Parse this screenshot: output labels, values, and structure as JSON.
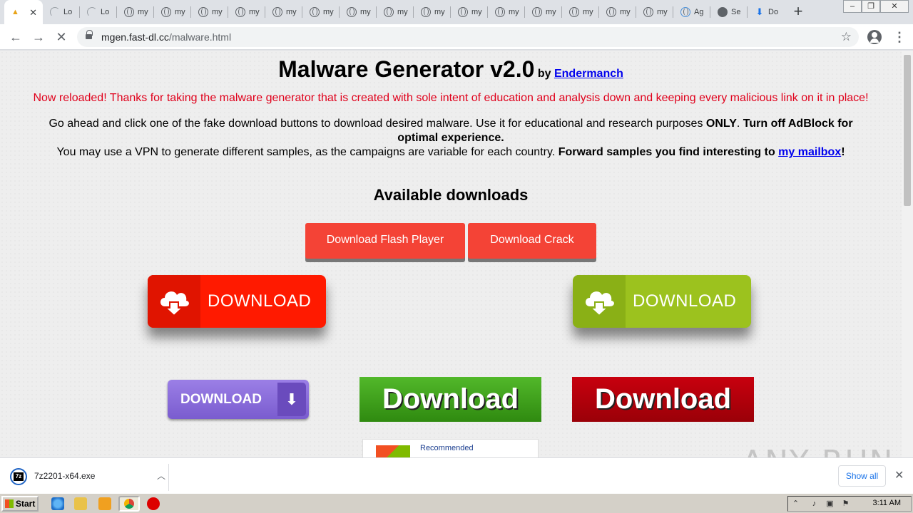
{
  "tabs": [
    {
      "label": "",
      "active": true
    },
    {
      "label": "Lo",
      "loading": true
    },
    {
      "label": "Lo",
      "loading": true
    },
    {
      "label": "my"
    },
    {
      "label": "my"
    },
    {
      "label": "my"
    },
    {
      "label": "my"
    },
    {
      "label": "my"
    },
    {
      "label": "my"
    },
    {
      "label": "my"
    },
    {
      "label": "my"
    },
    {
      "label": "my"
    },
    {
      "label": "my"
    },
    {
      "label": "my"
    },
    {
      "label": "my"
    },
    {
      "label": "my"
    },
    {
      "label": "my"
    },
    {
      "label": "my"
    },
    {
      "label": "Ag"
    },
    {
      "label": "Se"
    },
    {
      "label": "Do"
    }
  ],
  "toolbar": {
    "url_host": "mgen.fast-dl.cc",
    "url_path": "/malware.html"
  },
  "page": {
    "title": "Malware Generator v2.0",
    "by_prefix": "by",
    "author_link": "Endermanch",
    "notice": "Now reloaded! Thanks for taking the malware generator that is created with sole intent of education and analysis down and keeping every malicious link on it in place!",
    "intro_part1": "Go ahead and click one of the fake download buttons to download desired malware. Use it for educational and research purposes ",
    "intro_only": "ONLY",
    "intro_part2": ". ",
    "intro_adblock": "Turn off AdBlock for optimal experience.",
    "vpn_text": "You may use a VPN to generate different samples, as the campaigns are variable for each country. ",
    "forward_text": "Forward samples you find interesting to ",
    "mailbox_link": "my mailbox",
    "exclaim": "!",
    "available_heading": "Available downloads",
    "btn_flash": "Download Flash Player",
    "btn_crack": "Download Crack",
    "btn_red_big": "DOWNLOAD",
    "btn_green_big": "DOWNLOAD",
    "btn_purple": "DOWNLOAD",
    "btn_green_bold": "Download",
    "btn_darkred_bold": "Download",
    "recommended": "Recommended",
    "watermark": "ANY RUN"
  },
  "shelf": {
    "filename": "7z2201-x64.exe",
    "show_all": "Show all"
  },
  "taskbar": {
    "start": "Start",
    "clock": "3:11 AM"
  },
  "colors": {
    "notice_red": "#e0001b",
    "flat_red": "#f44336",
    "big_red": "#ff1a00",
    "big_green": "#9cc21e",
    "bold_green": "#3f9e1a",
    "bold_darkred": "#b0000a",
    "link_blue": "#0000ee"
  }
}
